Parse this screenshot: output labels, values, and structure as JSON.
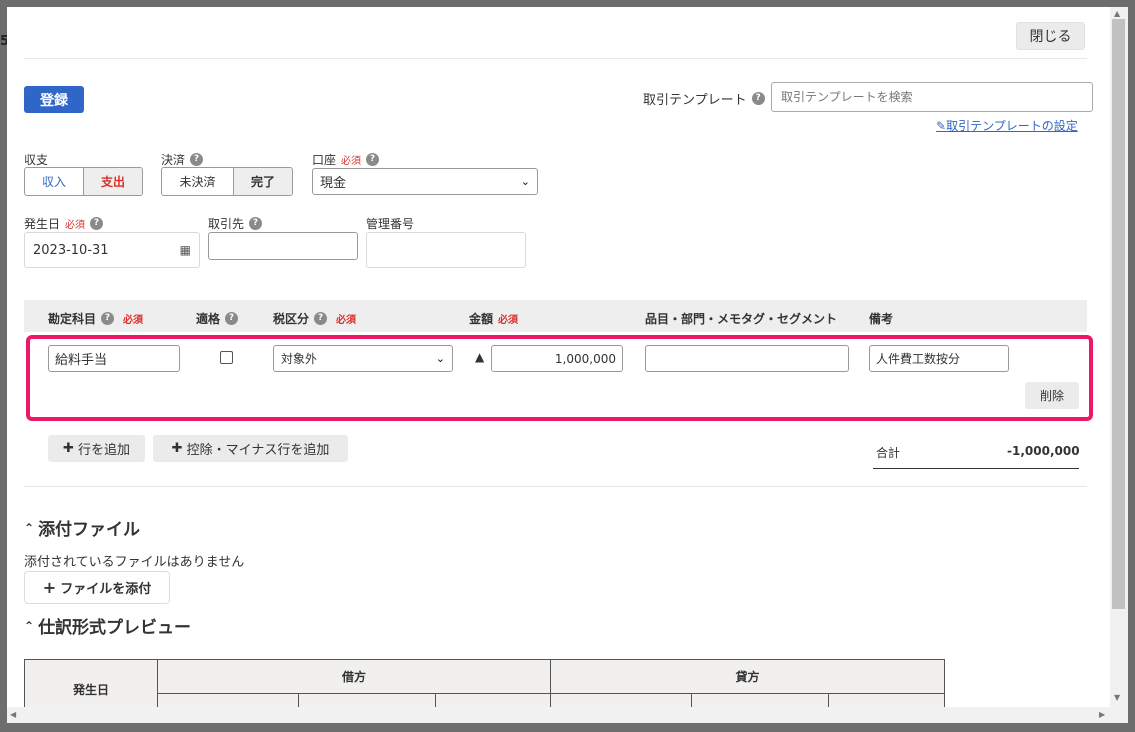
{
  "dialog": {
    "close_label": "閉じる",
    "register_label": "登録"
  },
  "template": {
    "label": "取引テンプレート",
    "search_placeholder": "取引テンプレートを検索",
    "settings_link": "取引テンプレートの設定"
  },
  "form": {
    "required_tag": "必須",
    "income_expense": {
      "label": "収支",
      "options": [
        "収入",
        "支出"
      ],
      "selected": "支出"
    },
    "settlement": {
      "label": "決済",
      "options": [
        "未決済",
        "完了"
      ],
      "selected": "完了"
    },
    "account": {
      "label": "口座",
      "value": "現金"
    },
    "issue_date": {
      "label": "発生日",
      "value": "2023-10-31"
    },
    "partner": {
      "label": "取引先",
      "value": ""
    },
    "management_no": {
      "label": "管理番号",
      "value": ""
    }
  },
  "detail_table": {
    "headers": {
      "account_item": "勘定科目",
      "qualified": "適格",
      "tax_category": "税区分",
      "amount": "金額",
      "tags": "品目・部門・メモタグ・セグメント",
      "remarks": "備考"
    },
    "row": {
      "account_item": "給料手当",
      "qualified": false,
      "tax_category": "対象外",
      "amount_sign": "▲",
      "amount": "1,000,000",
      "tags": "",
      "remarks": "人件費工数按分",
      "delete_label": "削除"
    },
    "add_row_label": "行を追加",
    "add_deduction_label": "控除・マイナス行を追加",
    "total_label": "合計",
    "total_value": "-1,000,000"
  },
  "attachments": {
    "title": "添付ファイル",
    "empty_note": "添付されているファイルはありません",
    "add_label": "ファイルを添付"
  },
  "preview": {
    "title": "仕訳形式プレビュー",
    "headers": {
      "date": "発生日",
      "debit": "借方",
      "credit": "貸方"
    }
  },
  "icons": {
    "calendar": "calendar-icon",
    "help": "help-icon",
    "edit": "edit-icon",
    "plus": "plus-icon",
    "caret": "caret-up-icon"
  },
  "colors": {
    "primary": "#2f66c8",
    "required": "#d9302b",
    "highlight": "#ec1865"
  }
}
